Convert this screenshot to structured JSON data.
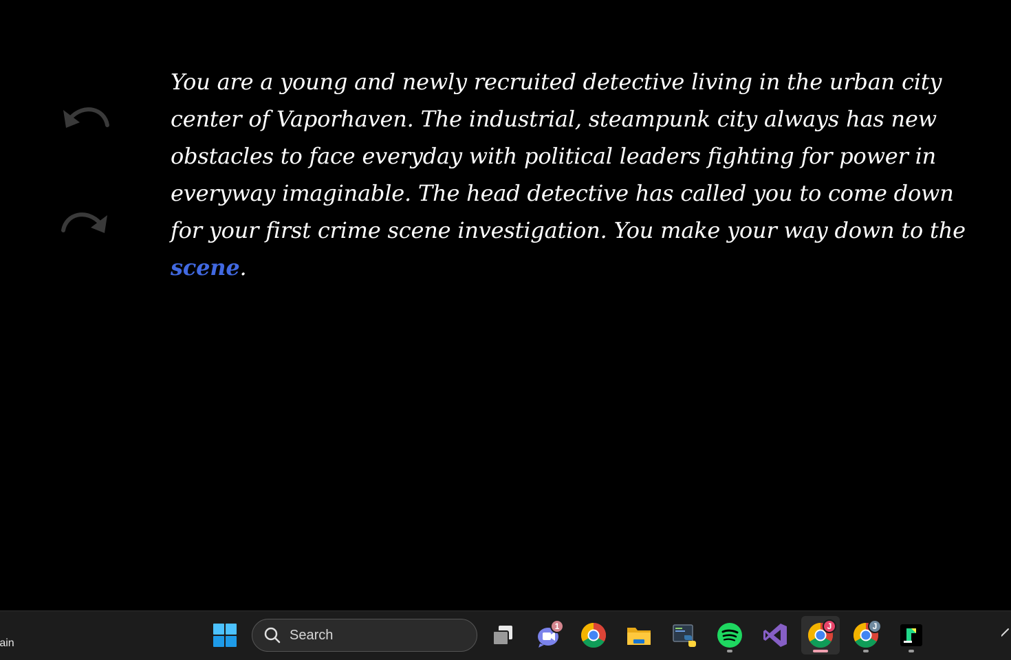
{
  "story": {
    "text": "You are a young and newly recruited detective living in the urban city center of Vaporhaven. The industrial, steampunk city always has new obstacles to face everyday with political leaders fighting for power in everyway imaginable. The head detective has called you to come down for your first crime scene investigation. You make your way down to the ",
    "link_text": "scene",
    "trailing": ".",
    "undo_icon": "undo-arrow",
    "redo_icon": "redo-arrow",
    "colors": {
      "background": "#000000",
      "text": "#ffffff",
      "link": "#4169e1",
      "icon": "#3a3a3a"
    }
  },
  "taskbar": {
    "weather_text": "rain",
    "search_placeholder": "Search",
    "apps": [
      {
        "name": "Start",
        "icon": "windows-logo-icon"
      },
      {
        "name": "Task View",
        "icon": "task-view-icon"
      },
      {
        "name": "Teams",
        "icon": "teams-icon",
        "badge": "1"
      },
      {
        "name": "Chrome",
        "icon": "chrome-icon"
      },
      {
        "name": "File Explorer",
        "icon": "folder-icon"
      },
      {
        "name": "Python",
        "icon": "python-icon"
      },
      {
        "name": "Spotify",
        "icon": "spotify-icon"
      },
      {
        "name": "Visual Studio",
        "icon": "visual-studio-icon"
      },
      {
        "name": "Chrome (J profile)",
        "icon": "chrome-icon",
        "badge": "J",
        "active": true
      },
      {
        "name": "Chrome (second J profile)",
        "icon": "chrome-icon",
        "badge": "J"
      },
      {
        "name": "PyCharm",
        "icon": "pycharm-icon"
      }
    ],
    "overflow_icon": "chevron-up-icon"
  }
}
